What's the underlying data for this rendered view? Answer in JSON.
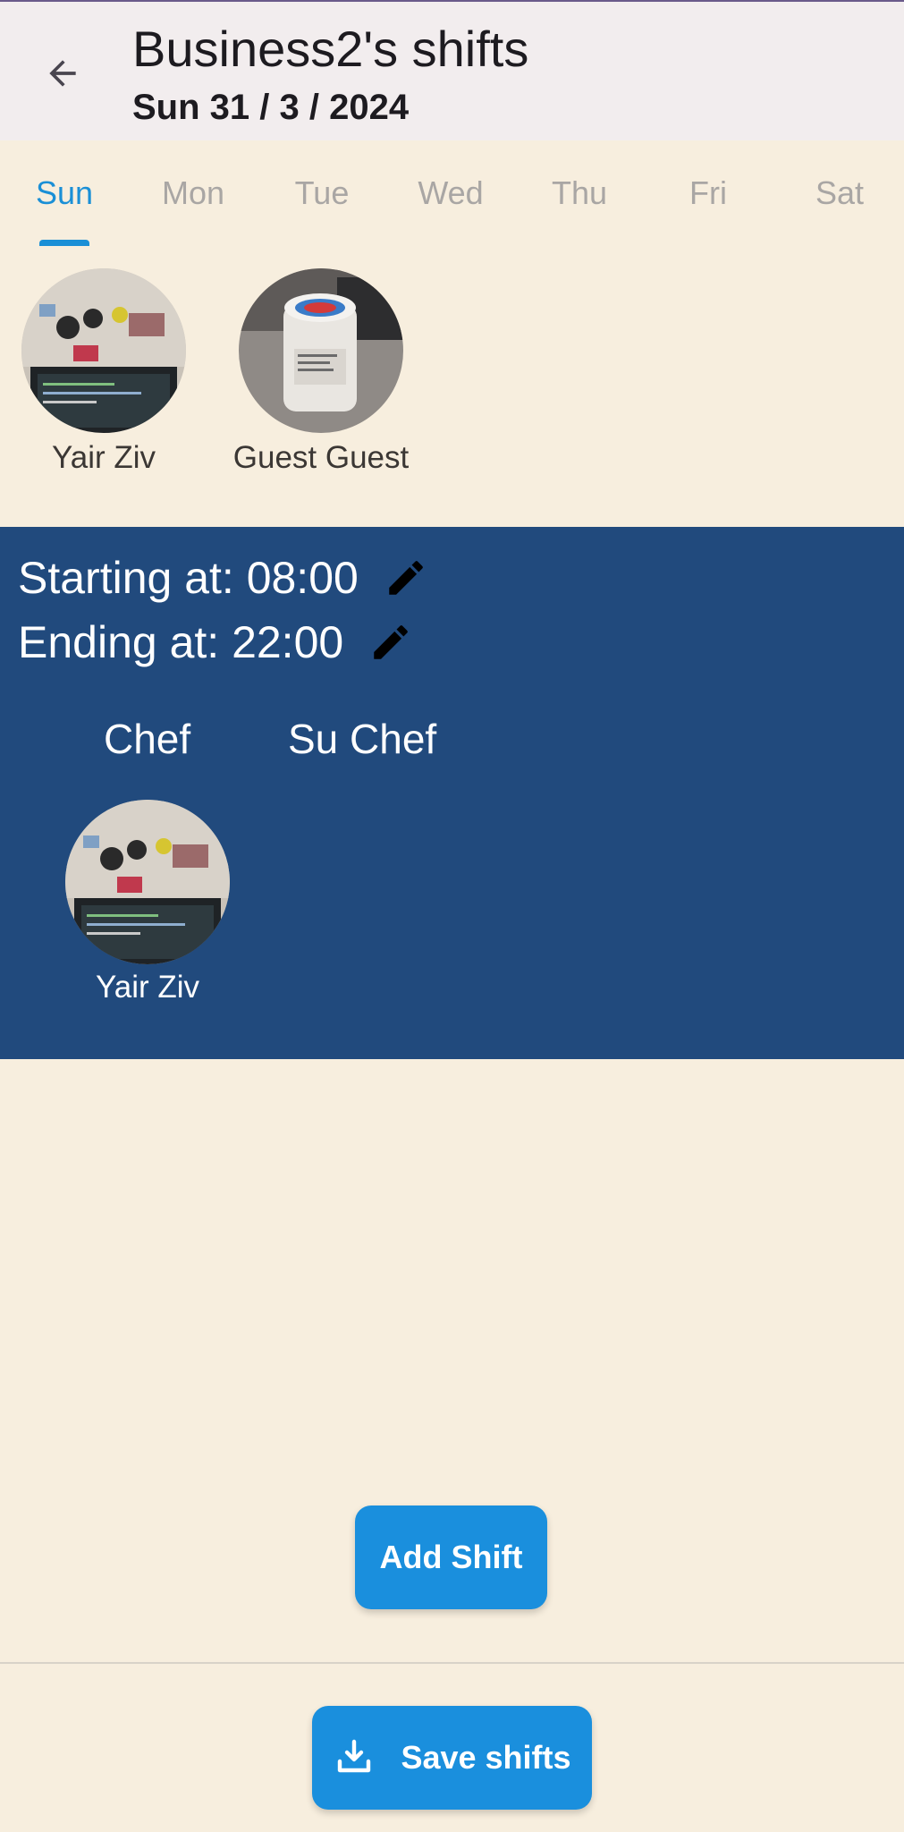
{
  "colors": {
    "background": "#f7eede",
    "appbar": "#f2edee",
    "accent": "#1a8fd6",
    "shift_card": "#214a7d",
    "button": "#1a8fdd"
  },
  "header": {
    "back_icon": "arrow-left-icon",
    "title": "Business2's shifts",
    "subtitle": "Sun 31 / 3 / 2024"
  },
  "tabs": [
    {
      "label": "Sun",
      "active": true
    },
    {
      "label": "Mon",
      "active": false
    },
    {
      "label": "Tue",
      "active": false
    },
    {
      "label": "Wed",
      "active": false
    },
    {
      "label": "Thu",
      "active": false
    },
    {
      "label": "Fri",
      "active": false
    },
    {
      "label": "Sat",
      "active": false
    }
  ],
  "employees": [
    {
      "name": "Yair Ziv"
    },
    {
      "name": "Guest Guest"
    }
  ],
  "shift": {
    "start_label": "Starting at: 08:00",
    "end_label": "Ending at: 22:00",
    "edit_icon": "pencil-icon",
    "roles": [
      "Chef",
      "Su Chef"
    ],
    "assigned": [
      {
        "name": "Yair Ziv",
        "role": "Chef"
      }
    ]
  },
  "actions": {
    "add_shift": "Add Shift",
    "save_shifts": "Save shifts",
    "save_icon": "download-icon"
  }
}
